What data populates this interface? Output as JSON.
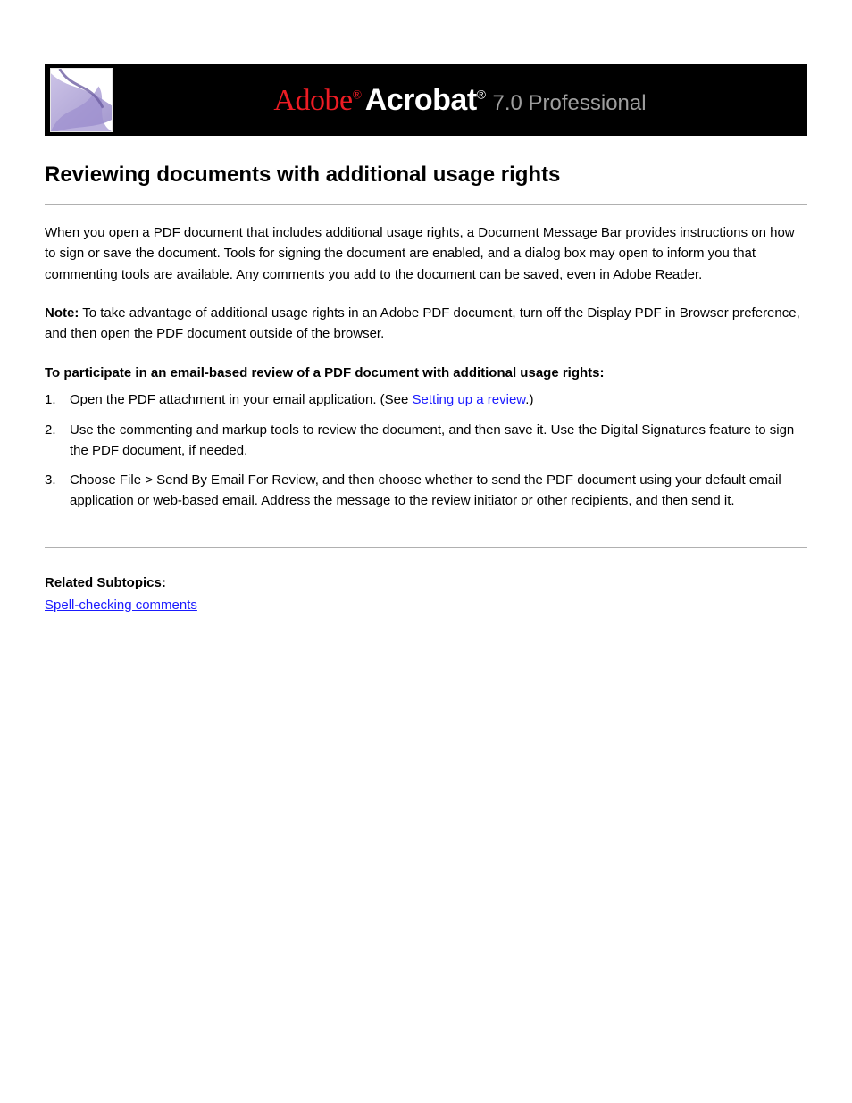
{
  "banner": {
    "brand": "Adobe",
    "brand_reg": "®",
    "product": "Acrobat",
    "product_reg": "®",
    "version_tail": "7.0 Professional"
  },
  "title": "Reviewing documents with additional usage rights",
  "intro": "When you open a PDF document that includes additional usage rights, a Document Message Bar provides instructions on how to sign or save the document. Tools for signing the document are enabled, and a dialog box may open to inform you that commenting tools are available. Any comments you add to the document can be saved, even in Adobe Reader.",
  "note": "Note: To take advantage of additional usage rights in an Adobe PDF document, turn off the Display PDF in Browser preference, and then open the PDF document outside of the browser.",
  "steps_heading": "To participate in an email-based review of a PDF document with additional usage rights:",
  "steps": [
    {
      "pre": "Open the PDF attachment in your email application. (See ",
      "link": "Setting up a review",
      "post": ".)"
    },
    {
      "text": "Use the commenting and markup tools to review the document, and then save it. Use the Digital Signatures feature to sign the PDF document, if needed."
    },
    {
      "text": "Choose File > Send By Email For Review, and then choose whether to send the PDF document using your default email application or web-based email. Address the message to the review initiator or other recipients, and then send it."
    }
  ],
  "subsections": [
    "Related Subtopics:",
    "Spell-checking comments"
  ],
  "related_heading": "Related Subtopics:",
  "related_items": [
    "Spell-checking comments"
  ]
}
